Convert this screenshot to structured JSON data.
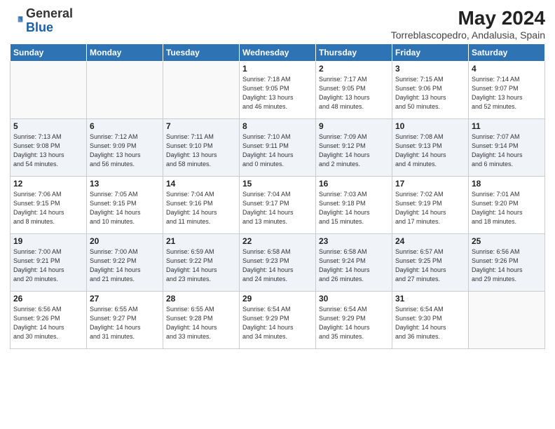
{
  "header": {
    "logo_general": "General",
    "logo_blue": "Blue",
    "title": "May 2024",
    "location": "Torreblascopedro, Andalusia, Spain"
  },
  "weekdays": [
    "Sunday",
    "Monday",
    "Tuesday",
    "Wednesday",
    "Thursday",
    "Friday",
    "Saturday"
  ],
  "weeks": [
    [
      {
        "day": "",
        "info": ""
      },
      {
        "day": "",
        "info": ""
      },
      {
        "day": "",
        "info": ""
      },
      {
        "day": "1",
        "info": "Sunrise: 7:18 AM\nSunset: 9:05 PM\nDaylight: 13 hours\nand 46 minutes."
      },
      {
        "day": "2",
        "info": "Sunrise: 7:17 AM\nSunset: 9:05 PM\nDaylight: 13 hours\nand 48 minutes."
      },
      {
        "day": "3",
        "info": "Sunrise: 7:15 AM\nSunset: 9:06 PM\nDaylight: 13 hours\nand 50 minutes."
      },
      {
        "day": "4",
        "info": "Sunrise: 7:14 AM\nSunset: 9:07 PM\nDaylight: 13 hours\nand 52 minutes."
      }
    ],
    [
      {
        "day": "5",
        "info": "Sunrise: 7:13 AM\nSunset: 9:08 PM\nDaylight: 13 hours\nand 54 minutes."
      },
      {
        "day": "6",
        "info": "Sunrise: 7:12 AM\nSunset: 9:09 PM\nDaylight: 13 hours\nand 56 minutes."
      },
      {
        "day": "7",
        "info": "Sunrise: 7:11 AM\nSunset: 9:10 PM\nDaylight: 13 hours\nand 58 minutes."
      },
      {
        "day": "8",
        "info": "Sunrise: 7:10 AM\nSunset: 9:11 PM\nDaylight: 14 hours\nand 0 minutes."
      },
      {
        "day": "9",
        "info": "Sunrise: 7:09 AM\nSunset: 9:12 PM\nDaylight: 14 hours\nand 2 minutes."
      },
      {
        "day": "10",
        "info": "Sunrise: 7:08 AM\nSunset: 9:13 PM\nDaylight: 14 hours\nand 4 minutes."
      },
      {
        "day": "11",
        "info": "Sunrise: 7:07 AM\nSunset: 9:14 PM\nDaylight: 14 hours\nand 6 minutes."
      }
    ],
    [
      {
        "day": "12",
        "info": "Sunrise: 7:06 AM\nSunset: 9:15 PM\nDaylight: 14 hours\nand 8 minutes."
      },
      {
        "day": "13",
        "info": "Sunrise: 7:05 AM\nSunset: 9:15 PM\nDaylight: 14 hours\nand 10 minutes."
      },
      {
        "day": "14",
        "info": "Sunrise: 7:04 AM\nSunset: 9:16 PM\nDaylight: 14 hours\nand 11 minutes."
      },
      {
        "day": "15",
        "info": "Sunrise: 7:04 AM\nSunset: 9:17 PM\nDaylight: 14 hours\nand 13 minutes."
      },
      {
        "day": "16",
        "info": "Sunrise: 7:03 AM\nSunset: 9:18 PM\nDaylight: 14 hours\nand 15 minutes."
      },
      {
        "day": "17",
        "info": "Sunrise: 7:02 AM\nSunset: 9:19 PM\nDaylight: 14 hours\nand 17 minutes."
      },
      {
        "day": "18",
        "info": "Sunrise: 7:01 AM\nSunset: 9:20 PM\nDaylight: 14 hours\nand 18 minutes."
      }
    ],
    [
      {
        "day": "19",
        "info": "Sunrise: 7:00 AM\nSunset: 9:21 PM\nDaylight: 14 hours\nand 20 minutes."
      },
      {
        "day": "20",
        "info": "Sunrise: 7:00 AM\nSunset: 9:22 PM\nDaylight: 14 hours\nand 21 minutes."
      },
      {
        "day": "21",
        "info": "Sunrise: 6:59 AM\nSunset: 9:22 PM\nDaylight: 14 hours\nand 23 minutes."
      },
      {
        "day": "22",
        "info": "Sunrise: 6:58 AM\nSunset: 9:23 PM\nDaylight: 14 hours\nand 24 minutes."
      },
      {
        "day": "23",
        "info": "Sunrise: 6:58 AM\nSunset: 9:24 PM\nDaylight: 14 hours\nand 26 minutes."
      },
      {
        "day": "24",
        "info": "Sunrise: 6:57 AM\nSunset: 9:25 PM\nDaylight: 14 hours\nand 27 minutes."
      },
      {
        "day": "25",
        "info": "Sunrise: 6:56 AM\nSunset: 9:26 PM\nDaylight: 14 hours\nand 29 minutes."
      }
    ],
    [
      {
        "day": "26",
        "info": "Sunrise: 6:56 AM\nSunset: 9:26 PM\nDaylight: 14 hours\nand 30 minutes."
      },
      {
        "day": "27",
        "info": "Sunrise: 6:55 AM\nSunset: 9:27 PM\nDaylight: 14 hours\nand 31 minutes."
      },
      {
        "day": "28",
        "info": "Sunrise: 6:55 AM\nSunset: 9:28 PM\nDaylight: 14 hours\nand 33 minutes."
      },
      {
        "day": "29",
        "info": "Sunrise: 6:54 AM\nSunset: 9:29 PM\nDaylight: 14 hours\nand 34 minutes."
      },
      {
        "day": "30",
        "info": "Sunrise: 6:54 AM\nSunset: 9:29 PM\nDaylight: 14 hours\nand 35 minutes."
      },
      {
        "day": "31",
        "info": "Sunrise: 6:54 AM\nSunset: 9:30 PM\nDaylight: 14 hours\nand 36 minutes."
      },
      {
        "day": "",
        "info": ""
      }
    ]
  ]
}
